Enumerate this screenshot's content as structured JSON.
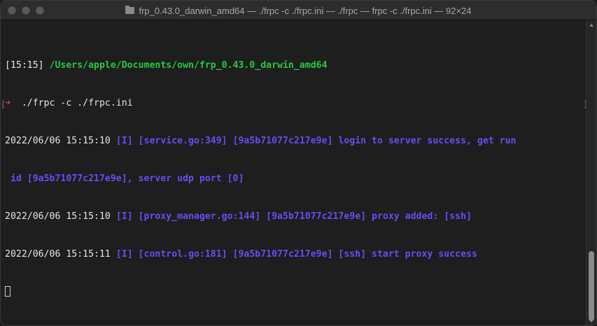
{
  "window": {
    "title": "frp_0.43.0_darwin_amd64 — ./frpc -c ./frpc.ini — ./frpc — frpc -c ./frpc.ini — 92×24"
  },
  "colors": {
    "path": "#27c93f",
    "log_text": "#6a4cf5",
    "prompt_arrow": "#e0443e"
  },
  "terminal": {
    "prompt": {
      "time": "[15:15]",
      "path": "/Users/apple/Documents/own/frp_0.43.0_darwin_amd64",
      "arrow": "➜",
      "command": "./frpc -c ./frpc.ini"
    },
    "logs": [
      {
        "timestamp": "2022/06/06 15:15:10",
        "text": "[I] [service.go:349] [9a5b71077c217e9e] login to server success, get run",
        "continuation": " id [9a5b71077c217e9e], server udp port [0]"
      },
      {
        "timestamp": "2022/06/06 15:15:10",
        "text": "[I] [proxy_manager.go:144] [9a5b71077c217e9e] proxy added: [ssh]"
      },
      {
        "timestamp": "2022/06/06 15:15:11",
        "text": "[I] [control.go:181] [9a5b71077c217e9e] [ssh] start proxy success"
      }
    ]
  }
}
